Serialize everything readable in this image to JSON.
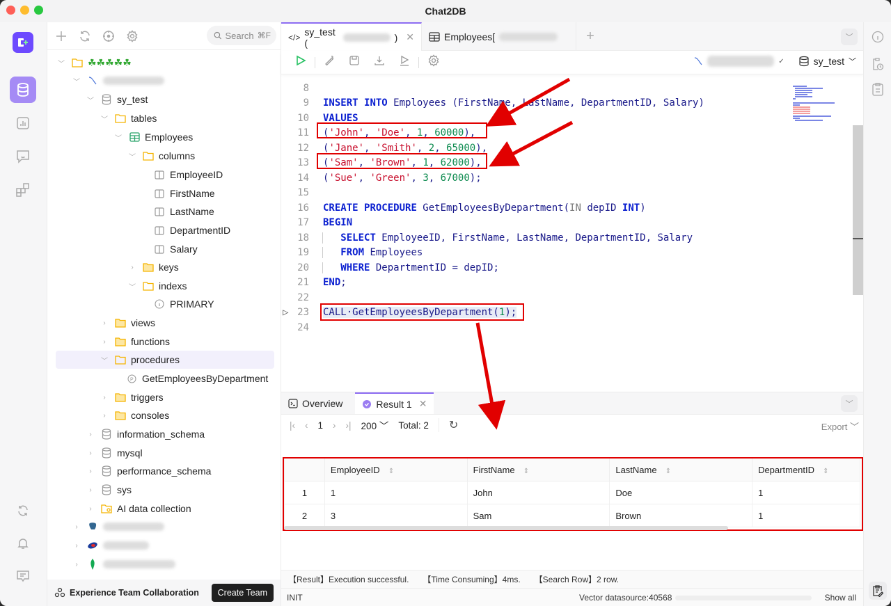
{
  "app": {
    "title": "Chat2DB"
  },
  "explorer": {
    "search_placeholder": "Search",
    "search_shortcut": "⌘F",
    "tree": {
      "root_label": "☘☘☘☘☘",
      "database": "sy_test",
      "tables_folder": "tables",
      "table": "Employees",
      "columns_folder": "columns",
      "columns": [
        "EmployeeID",
        "FirstName",
        "LastName",
        "DepartmentID",
        "Salary"
      ],
      "keys_folder": "keys",
      "indexes_folder": "indexs",
      "index": "PRIMARY",
      "views_folder": "views",
      "functions_folder": "functions",
      "procedures_folder": "procedures",
      "procedure": "GetEmployeesByDepartment",
      "triggers_folder": "triggers",
      "consoles_folder": "consoles",
      "other_databases": [
        "information_schema",
        "mysql",
        "performance_schema",
        "sys"
      ],
      "ai_collection": "AI data collection"
    },
    "footer": {
      "label": "Experience Team Collaboration",
      "button": "Create Team"
    }
  },
  "tabs": [
    {
      "label": "sy_test (",
      "suffix": ")",
      "icon": "code-icon"
    },
    {
      "label": "Employees[",
      "icon": "table-icon"
    }
  ],
  "editor": {
    "database_selector": "sy_test",
    "lines": [
      {
        "n": "8",
        "tokens": []
      },
      {
        "n": "9",
        "tokens": [
          [
            "k",
            "INSERT"
          ],
          [
            "p",
            " "
          ],
          [
            "k",
            "INTO"
          ],
          [
            "n",
            " Employees (FirstName, LastName, DepartmentID, Salary)"
          ]
        ]
      },
      {
        "n": "10",
        "tokens": [
          [
            "k",
            "VALUES"
          ]
        ]
      },
      {
        "n": "11",
        "tokens": [
          [
            "p",
            "("
          ],
          [
            "s",
            "'John'"
          ],
          [
            "p",
            ", "
          ],
          [
            "s",
            "'Doe'"
          ],
          [
            "p",
            ", "
          ],
          [
            "num",
            "1"
          ],
          [
            "p",
            ", "
          ],
          [
            "num",
            "60000"
          ],
          [
            "p",
            "),"
          ]
        ]
      },
      {
        "n": "12",
        "tokens": [
          [
            "p",
            "("
          ],
          [
            "s",
            "'Jane'"
          ],
          [
            "p",
            ", "
          ],
          [
            "s",
            "'Smith'"
          ],
          [
            "p",
            ", "
          ],
          [
            "num",
            "2"
          ],
          [
            "p",
            ", "
          ],
          [
            "num",
            "65000"
          ],
          [
            "p",
            "),"
          ]
        ]
      },
      {
        "n": "13",
        "tokens": [
          [
            "p",
            "("
          ],
          [
            "s",
            "'Sam'"
          ],
          [
            "p",
            ", "
          ],
          [
            "s",
            "'Brown'"
          ],
          [
            "p",
            ", "
          ],
          [
            "num",
            "1"
          ],
          [
            "p",
            ", "
          ],
          [
            "num",
            "62000"
          ],
          [
            "p",
            "),"
          ]
        ]
      },
      {
        "n": "14",
        "tokens": [
          [
            "p",
            "("
          ],
          [
            "s",
            "'Sue'"
          ],
          [
            "p",
            ", "
          ],
          [
            "s",
            "'Green'"
          ],
          [
            "p",
            ", "
          ],
          [
            "num",
            "3"
          ],
          [
            "p",
            ", "
          ],
          [
            "num",
            "67000"
          ],
          [
            "p",
            ");"
          ]
        ]
      },
      {
        "n": "15",
        "tokens": []
      },
      {
        "n": "16",
        "tokens": [
          [
            "k",
            "CREATE"
          ],
          [
            "p",
            " "
          ],
          [
            "k",
            "PROCEDURE"
          ],
          [
            "n",
            " GetEmployeesByDepartment("
          ],
          [
            "kw2",
            "IN"
          ],
          [
            "n",
            " depID "
          ],
          [
            "k",
            "INT"
          ],
          [
            "n",
            ")"
          ]
        ]
      },
      {
        "n": "17",
        "tokens": [
          [
            "k",
            "BEGIN"
          ]
        ]
      },
      {
        "n": "18",
        "tokens": [
          [
            "p",
            "   "
          ],
          [
            "k",
            "SELECT"
          ],
          [
            "n",
            " EmployeeID, FirstName, LastName, DepartmentID, Salary"
          ]
        ]
      },
      {
        "n": "19",
        "tokens": [
          [
            "p",
            "   "
          ],
          [
            "k",
            "FROM"
          ],
          [
            "n",
            " Employees"
          ]
        ]
      },
      {
        "n": "20",
        "tokens": [
          [
            "p",
            "   "
          ],
          [
            "k",
            "WHERE"
          ],
          [
            "n",
            " DepartmentID = depID;"
          ]
        ]
      },
      {
        "n": "21",
        "tokens": [
          [
            "k",
            "END"
          ],
          [
            "n",
            ";"
          ]
        ]
      },
      {
        "n": "22",
        "tokens": []
      },
      {
        "n": "23",
        "tokens": [
          [
            "n",
            "CALL·GetEmployeesByDepartment("
          ],
          [
            "num",
            "1"
          ],
          [
            "n",
            ");"
          ]
        ]
      },
      {
        "n": "24",
        "tokens": []
      }
    ]
  },
  "results": {
    "tabs": [
      "Overview",
      "Result 1"
    ],
    "page": "1",
    "page_size": "200",
    "total_label": "Total:",
    "total": "2",
    "export_label": "Export",
    "columns": [
      "EmployeeID",
      "FirstName",
      "LastName",
      "DepartmentID"
    ],
    "rows": [
      {
        "n": "1",
        "cells": [
          "1",
          "John",
          "Doe",
          "1"
        ]
      },
      {
        "n": "2",
        "cells": [
          "3",
          "Sam",
          "Brown",
          "1"
        ]
      }
    ]
  },
  "status": {
    "result": "【Result】Execution successful.",
    "time": "【Time Consuming】4ms.",
    "rows": "【Search Row】2 row.",
    "init": "INIT",
    "vector": "Vector datasource:40568",
    "show_all": "Show all"
  },
  "colors": {
    "accent": "#8c6cf2",
    "annotation": "#e10000",
    "keyword": "#0a1fd0",
    "string": "#c8102e",
    "number": "#0b8a4e"
  }
}
